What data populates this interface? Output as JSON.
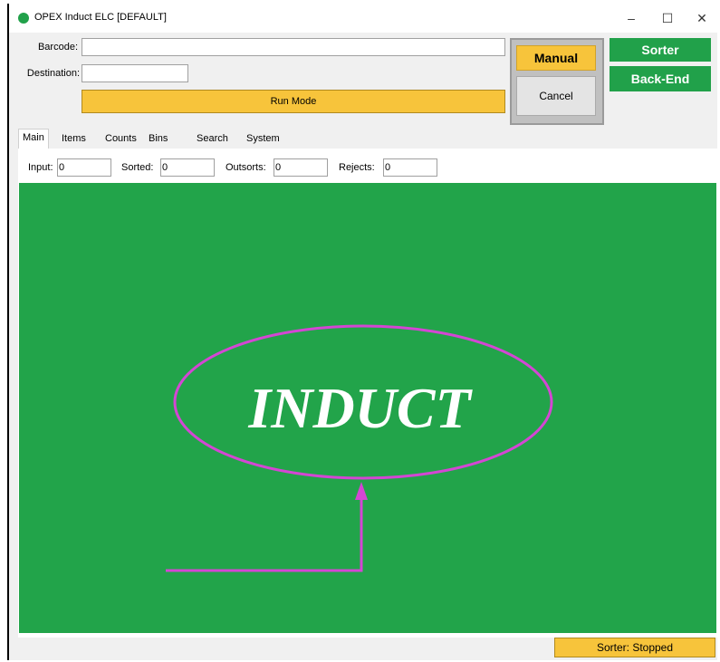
{
  "window": {
    "title": "OPEX Induct ELC [DEFAULT]",
    "minimize": "–",
    "maximize": "☐",
    "close": "✕"
  },
  "form": {
    "barcode_label": "Barcode:",
    "destination_label": "Destination:",
    "run_mode": "Run Mode"
  },
  "buttons": {
    "manual": "Manual",
    "cancel": "Cancel",
    "sorter": "Sorter",
    "back_end": "Back-End"
  },
  "tabs": [
    "Main",
    "Items",
    "Counts",
    "Bins",
    "Search",
    "System"
  ],
  "counters": [
    {
      "label": "Input:",
      "value": "0"
    },
    {
      "label": "Sorted:",
      "value": "0"
    },
    {
      "label": "Outsorts:",
      "value": "0"
    },
    {
      "label": "Rejects:",
      "value": "0"
    }
  ],
  "canvas": {
    "text": "INDUCT"
  },
  "status": {
    "text": "Sorter: Stopped"
  },
  "colors": {
    "green": "#21a14a",
    "yellow": "#f7c43b",
    "annotation": "#d446d4"
  }
}
